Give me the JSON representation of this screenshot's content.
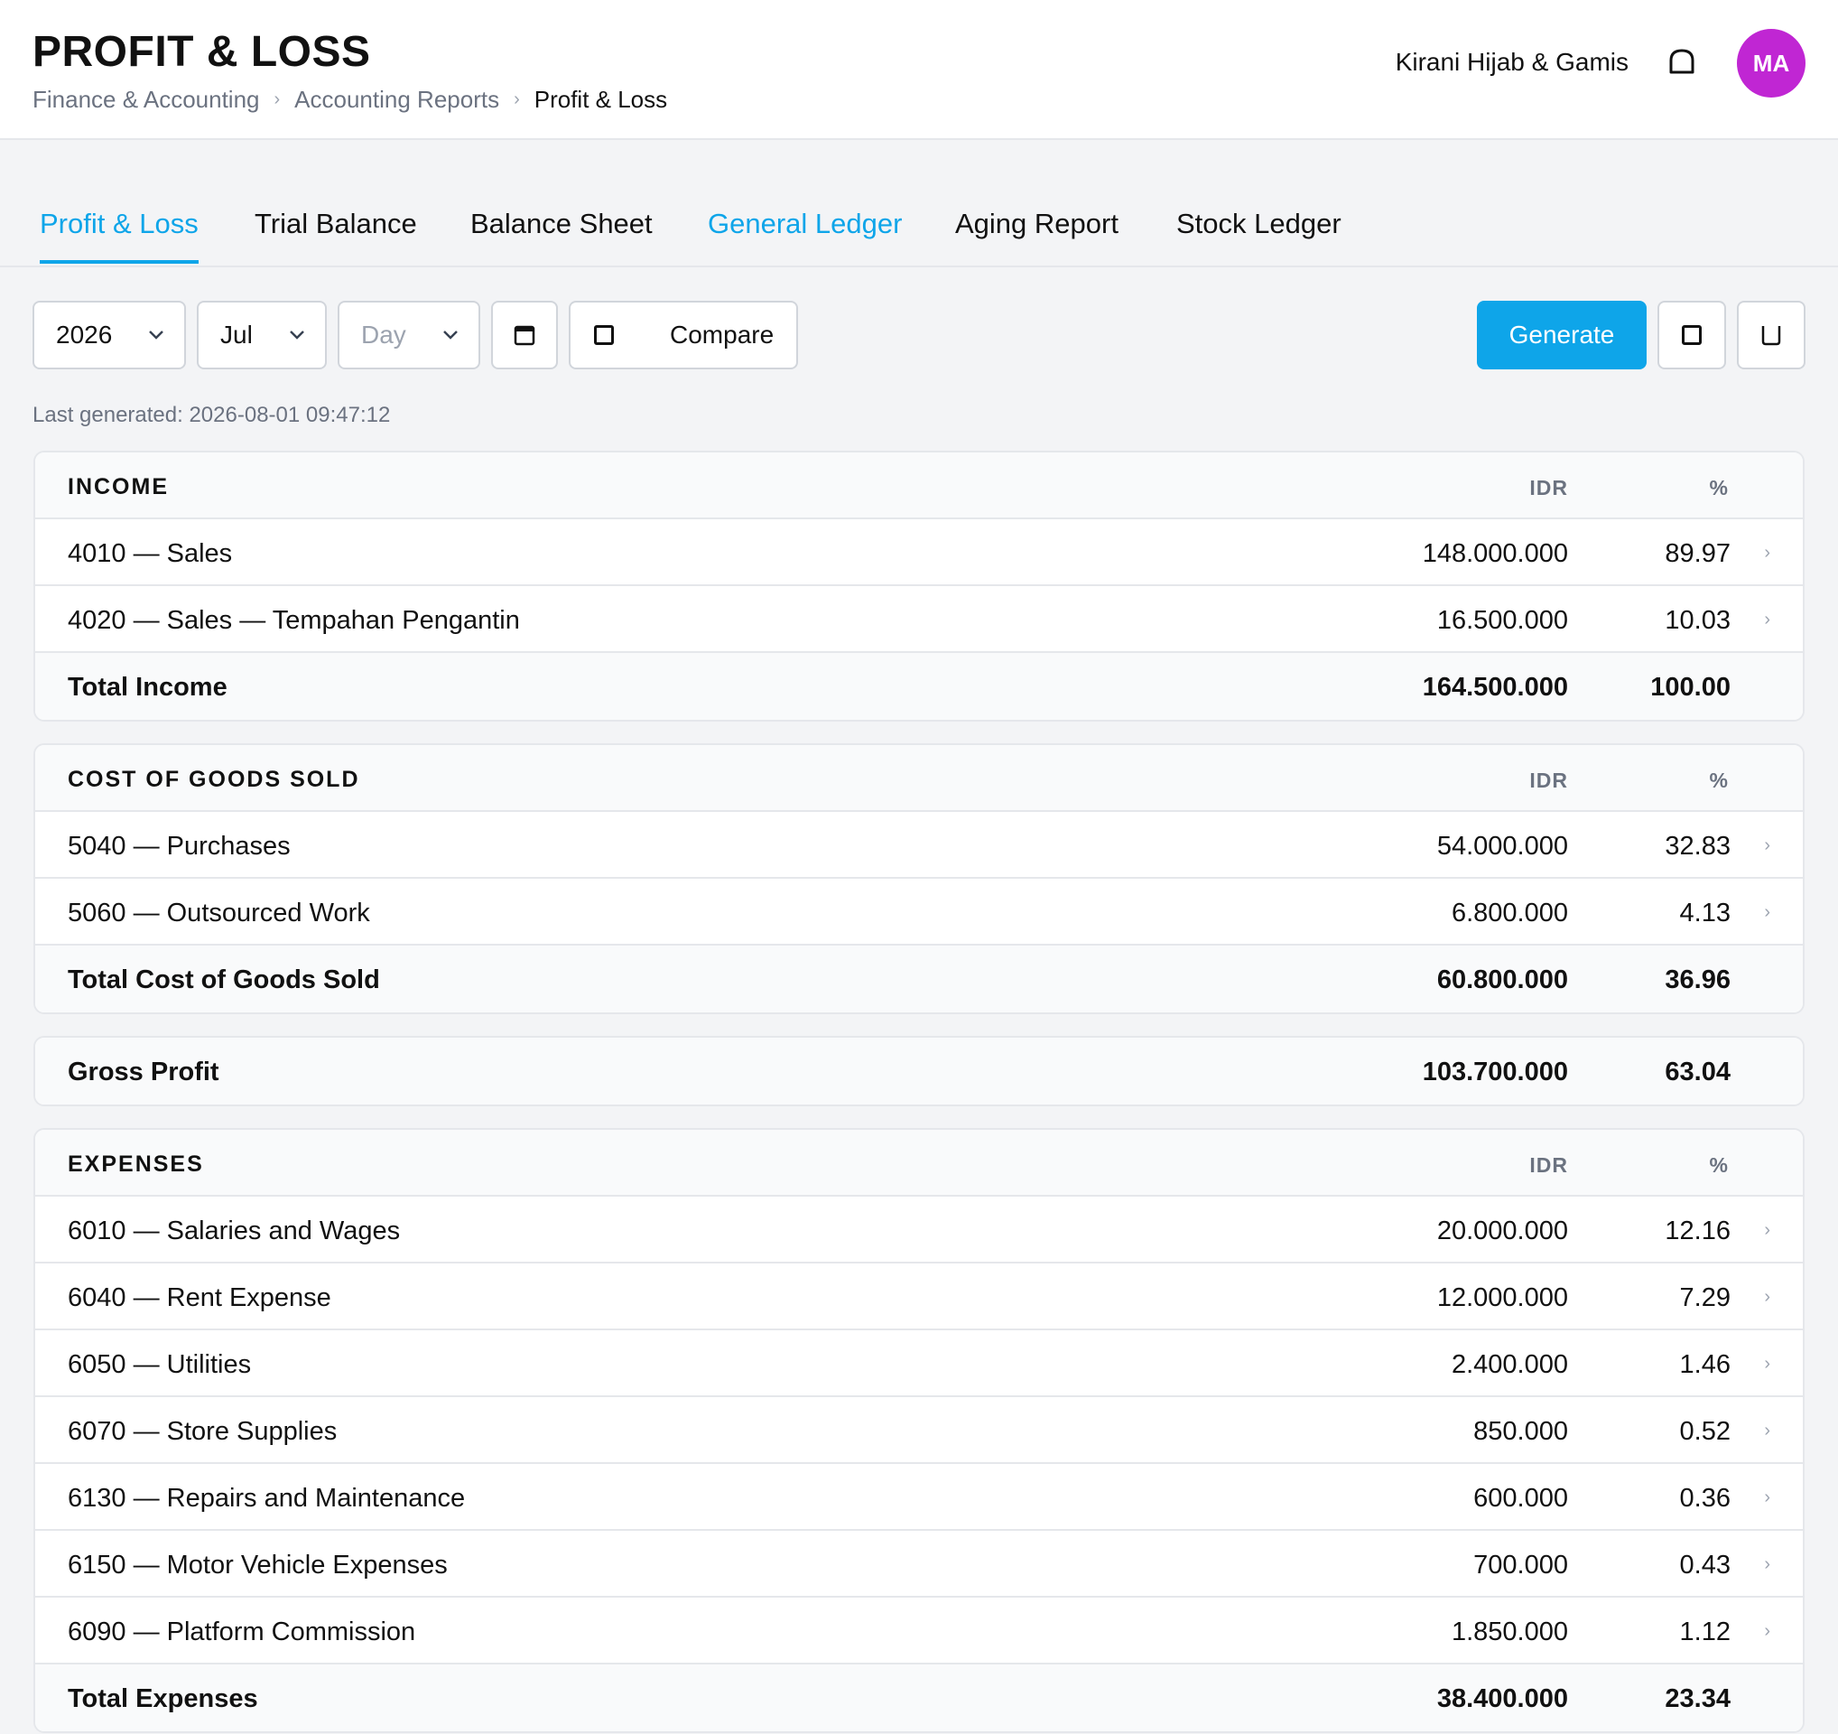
{
  "header": {
    "title": "PROFIT & LOSS",
    "breadcrumb": [
      "Finance & Accounting",
      "Accounting Reports",
      "Profit & Loss"
    ],
    "breadcrumb_sep": "›",
    "company": "Kirani Hijab & Gamis",
    "avatar_initials": "MA",
    "avatar_color": "#c026d3"
  },
  "tabs": [
    {
      "label": "Profit & Loss",
      "state": "active"
    },
    {
      "label": "Trial Balance",
      "state": "normal"
    },
    {
      "label": "Balance Sheet",
      "state": "normal"
    },
    {
      "label": "General Ledger",
      "state": "link"
    },
    {
      "label": "Aging Report",
      "state": "normal"
    },
    {
      "label": "Stock Ledger",
      "state": "normal"
    }
  ],
  "toolbar": {
    "year": "2026",
    "month": "Jul",
    "day_placeholder": "Day",
    "compare_label": "Compare",
    "generate_label": "Generate",
    "accent_color": "#0ea5e9"
  },
  "last_generated": "Last generated: 2026-08-01 09:47:12",
  "columns": {
    "amount": "IDR",
    "percent": "%"
  },
  "sections": {
    "income": {
      "title": "INCOME",
      "rows": [
        {
          "label": "4010 — Sales",
          "amount": "148.000.000",
          "pct": "89.97"
        },
        {
          "label": "4020 — Sales — Tempahan Pengantin",
          "amount": "16.500.000",
          "pct": "10.03"
        }
      ],
      "total": {
        "label": "Total Income",
        "amount": "164.500.000",
        "pct": "100.00"
      }
    },
    "cogs": {
      "title": "COST OF GOODS SOLD",
      "rows": [
        {
          "label": "5040 — Purchases",
          "amount": "54.000.000",
          "pct": "32.83"
        },
        {
          "label": "5060 — Outsourced Work",
          "amount": "6.800.000",
          "pct": "4.13"
        }
      ],
      "total": {
        "label": "Total Cost of Goods Sold",
        "amount": "60.800.000",
        "pct": "36.96"
      }
    },
    "gross_profit": {
      "label": "Gross Profit",
      "amount": "103.700.000",
      "pct": "63.04"
    },
    "expenses": {
      "title": "EXPENSES",
      "rows": [
        {
          "label": "6010 — Salaries and Wages",
          "amount": "20.000.000",
          "pct": "12.16"
        },
        {
          "label": "6040 — Rent Expense",
          "amount": "12.000.000",
          "pct": "7.29"
        },
        {
          "label": "6050 — Utilities",
          "amount": "2.400.000",
          "pct": "1.46"
        },
        {
          "label": "6070 — Store Supplies",
          "amount": "850.000",
          "pct": "0.52"
        },
        {
          "label": "6130 — Repairs and Maintenance",
          "amount": "600.000",
          "pct": "0.36"
        },
        {
          "label": "6150 — Motor Vehicle Expenses",
          "amount": "700.000",
          "pct": "0.43"
        },
        {
          "label": "6090 — Platform Commission",
          "amount": "1.850.000",
          "pct": "1.12"
        }
      ],
      "total": {
        "label": "Total Expenses",
        "amount": "38.400.000",
        "pct": "23.34"
      }
    }
  },
  "row_arrow": "›"
}
